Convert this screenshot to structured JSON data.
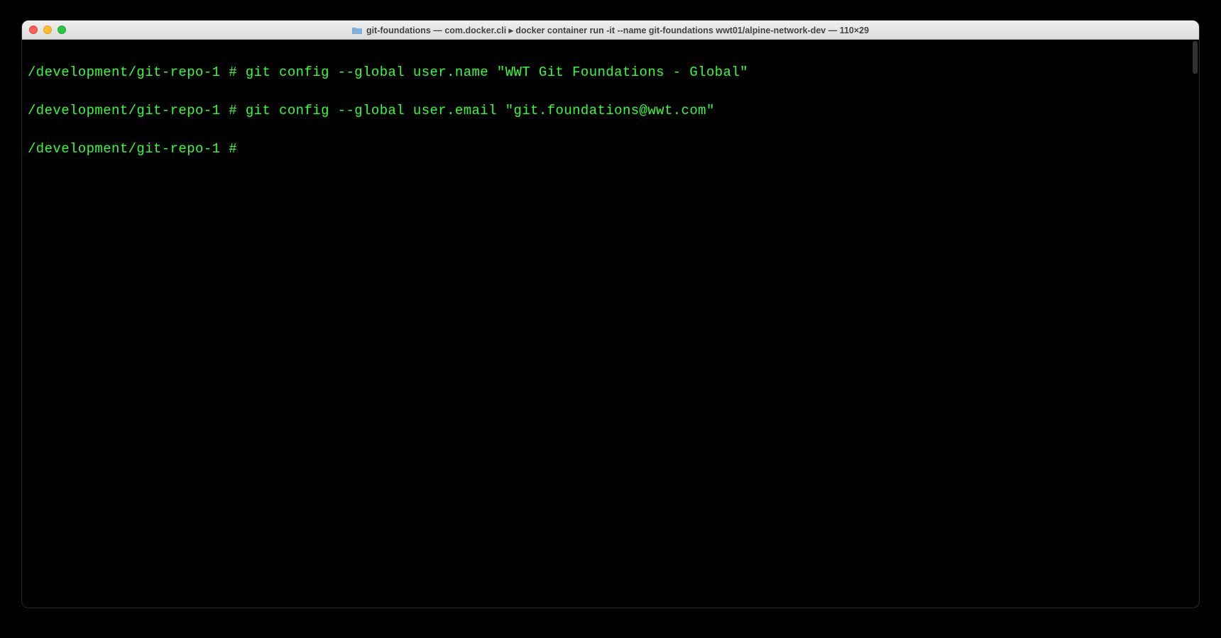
{
  "window": {
    "title": "git-foundations — com.docker.cli ▸ docker container run -it --name git-foundations wwt01/alpine-network-dev — 110×29"
  },
  "terminal": {
    "lines": [
      {
        "prompt": "/development/git-repo-1 #",
        "command": "git config --global user.name \"WWT Git Foundations - Global\""
      },
      {
        "prompt": "/development/git-repo-1 #",
        "command": "git config --global user.email \"git.foundations@wwt.com\""
      },
      {
        "prompt": "/development/git-repo-1 #",
        "command": ""
      }
    ]
  },
  "colors": {
    "terminal_fg": "#33ff33",
    "terminal_bg": "#000000",
    "titlebar_top": "#efefef",
    "titlebar_bottom": "#dcdcdc"
  }
}
